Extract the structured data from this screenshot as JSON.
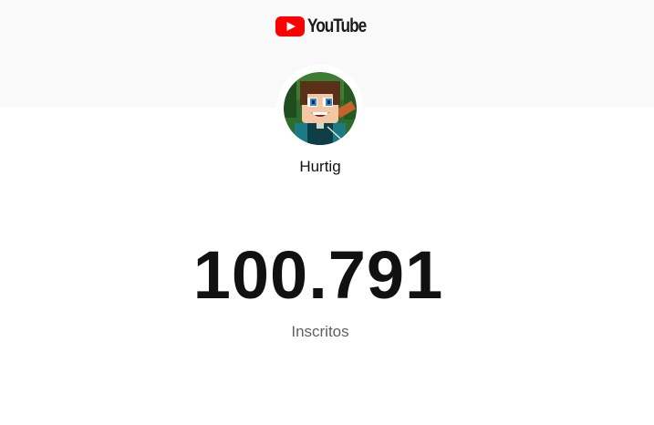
{
  "header": {
    "logo_text": "YouTube",
    "logo_icon": "youtube-play-icon",
    "brand_color": "#ff0000",
    "band_color": "#f9f9f9"
  },
  "channel": {
    "name": "Hurtig",
    "avatar": "channel-avatar"
  },
  "stats": {
    "subscriber_count": "100.791",
    "subscriber_label": "Inscritos"
  }
}
